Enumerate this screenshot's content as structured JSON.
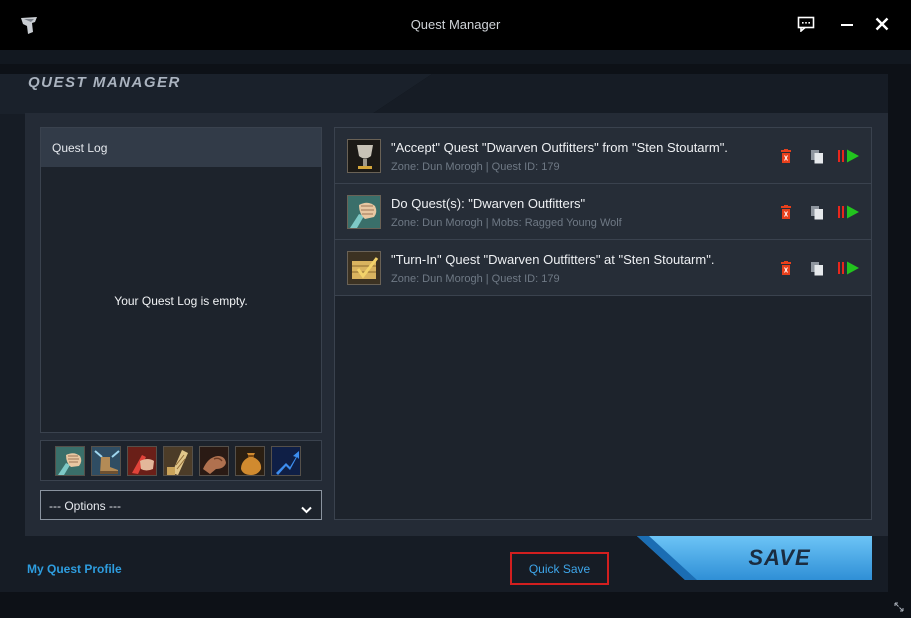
{
  "window": {
    "title": "Quest Manager"
  },
  "header": {
    "heading": "QUEST MANAGER"
  },
  "quest_log": {
    "title": "Quest Log",
    "empty_text": "Your Quest Log is empty."
  },
  "icon_bar": {
    "icons": [
      "fist-icon",
      "boot-icon",
      "hand-icon",
      "scroll-icon",
      "flex-arm-icon",
      "loot-bag-icon",
      "arrow-up-icon"
    ]
  },
  "options": {
    "selected": "--- Options ---"
  },
  "quests": [
    {
      "icon": "goblet-icon",
      "title": "\"Accept\" Quest \"Dwarven Outfitters\" from \"Sten Stoutarm\".",
      "subtitle": "Zone: Dun Morogh | Quest ID: 179"
    },
    {
      "icon": "fist-icon",
      "title": "Do Quest(s): \"Dwarven Outfitters\"",
      "subtitle": "Zone: Dun Morogh | Mobs: Ragged Young Wolf"
    },
    {
      "icon": "checkmark-scroll-icon",
      "title": "\"Turn-In\" Quest \"Dwarven Outfitters\" at \"Sten Stoutarm\".",
      "subtitle": "Zone: Dun Morogh | Quest ID: 179"
    }
  ],
  "footer": {
    "profile_link": "My Quest Profile",
    "quick_save": "Quick Save",
    "save": "SAVE"
  },
  "colors": {
    "accent_blue": "#2e9ddf",
    "delete_red": "#e8401c",
    "play_green": "#22c41e",
    "highlight_red": "#d21f1f"
  }
}
